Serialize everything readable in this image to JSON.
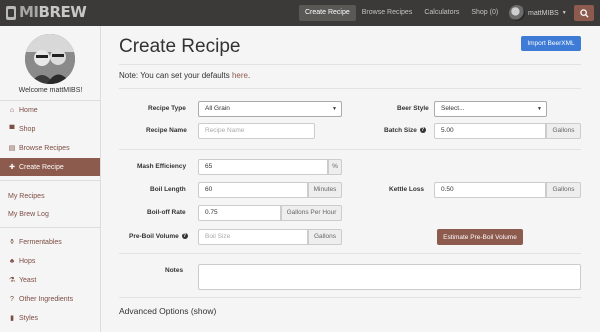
{
  "navbar": {
    "logo": {
      "mi": "MI",
      "brew": "BREW"
    },
    "links": [
      "Create Recipe",
      "Browse Recipes",
      "Calculators",
      "Shop (0)"
    ],
    "user": "mattMIBS",
    "colors": {
      "bar": "#3b3a38",
      "accent": "#8d5a4e"
    }
  },
  "sidebar": {
    "welcome": "Welcome mattMIBS!",
    "items": [
      {
        "label": "Home",
        "icon": "home-icon"
      },
      {
        "label": "Shop",
        "icon": "cart-icon"
      },
      {
        "label": "Browse Recipes",
        "icon": "book-icon"
      },
      {
        "label": "Create Recipe",
        "icon": "plus-icon"
      },
      {
        "label": "My Recipes"
      },
      {
        "label": "My Brew Log"
      },
      {
        "label": "Fermentables",
        "icon": "flask-icon"
      },
      {
        "label": "Hops",
        "icon": "hop-icon"
      },
      {
        "label": "Yeast",
        "icon": "yeast-icon"
      },
      {
        "label": "Other Ingredients",
        "icon": "question-icon"
      },
      {
        "label": "Styles",
        "icon": "glass-icon"
      }
    ]
  },
  "main": {
    "title": "Create Recipe",
    "import_button": "Import BeerXML",
    "note_prefix": "Note: You can set your defaults ",
    "note_link": "here",
    "note_suffix": ".",
    "form": {
      "recipe_type": {
        "label": "Recipe Type",
        "value": "All Grain"
      },
      "beer_style": {
        "label": "Beer Style",
        "value": "Select..."
      },
      "recipe_name": {
        "label": "Recipe Name",
        "placeholder": "Recipe Name"
      },
      "batch_size": {
        "label": "Batch Size",
        "value": "5.00",
        "unit": "Gallons"
      },
      "mash_efficiency": {
        "label": "Mash Efficiency",
        "value": "65",
        "unit": "%"
      },
      "boil_length": {
        "label": "Boil Length",
        "value": "60",
        "unit": "Minutes"
      },
      "kettle_loss": {
        "label": "Kettle Loss",
        "value": "0.50",
        "unit": "Gallons"
      },
      "boiloff_rate": {
        "label": "Boil-off Rate",
        "value": "0.75",
        "unit": "Gallons Per Hour"
      },
      "pre_boil_volume": {
        "label": "Pre-Boil Volume",
        "placeholder": "Boil Size",
        "unit": "Gallons"
      },
      "estimate_button": "Estimate Pre-Boil Volume",
      "notes": {
        "label": "Notes"
      }
    },
    "advanced": "Advanced Options (show)"
  }
}
